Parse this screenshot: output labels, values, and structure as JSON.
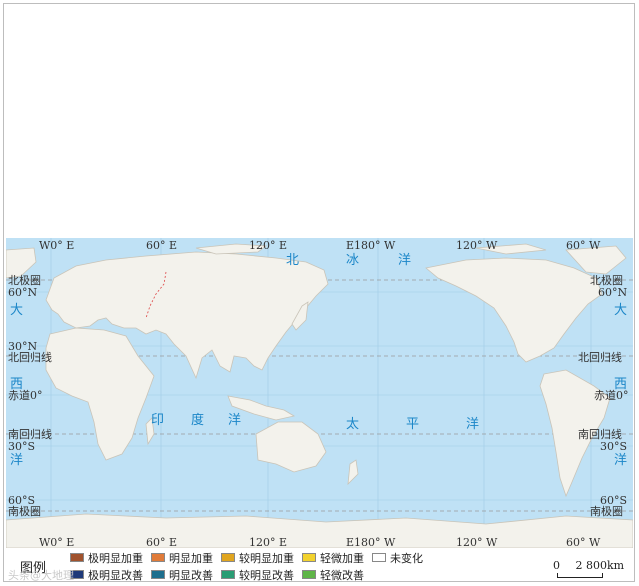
{
  "map": {
    "top_labels": [
      "W0° E",
      "60° E",
      "120° E",
      "E180° W",
      "120° W",
      "60° W"
    ],
    "bottom_labels": [
      "W0° E",
      "60° E",
      "120° E",
      "E180° W",
      "120° W",
      "60° W"
    ],
    "left_lat": {
      "arctic": "北极圈",
      "n60": "60°N",
      "n30": "30°N",
      "cancer": "北回归线",
      "equator": "赤道0°",
      "capricorn": "南回归线",
      "s30": "30°S",
      "s60": "60°S",
      "antarctic": "南极圈"
    },
    "right_lat": {
      "arctic": "北极圈",
      "n60": "60°N",
      "cancer": "北回归线",
      "equator": "赤道0°",
      "capricorn": "南回归线",
      "s30": "30°S",
      "s60": "60°S",
      "antarctic": "南极圈"
    },
    "oceans": {
      "arctic": [
        "北",
        "冰",
        "洋"
      ],
      "indian": [
        "印",
        "度",
        "洋"
      ],
      "pacific": [
        "太",
        "平",
        "洋"
      ],
      "atlantic_left": [
        "大",
        "西",
        "洋"
      ],
      "atlantic_right": [
        "大",
        "西",
        "洋"
      ]
    },
    "colors": {
      "ocean": "#bfe1f5",
      "land": "#f3f2ec",
      "coast": "#c9c4b8"
    }
  },
  "legend": {
    "title": "图例",
    "items": [
      {
        "label": "极明显加重",
        "color": "#a0522d"
      },
      {
        "label": "明显加重",
        "color": "#e07b39"
      },
      {
        "label": "较明显加重",
        "color": "#e0a51f"
      },
      {
        "label": "轻微加重",
        "color": "#f2d22e"
      },
      {
        "label": "未变化",
        "color": "#ffffff"
      },
      {
        "label": "极明显改善",
        "color": "#1f3a7a"
      },
      {
        "label": "明显改善",
        "color": "#1e6f8e"
      },
      {
        "label": "较明显改善",
        "color": "#2a9d74"
      },
      {
        "label": "轻微改善",
        "color": "#5fb548"
      }
    ]
  },
  "scale": {
    "zero": "0",
    "distance": "2 800km"
  },
  "watermark": "头条@大地理"
}
